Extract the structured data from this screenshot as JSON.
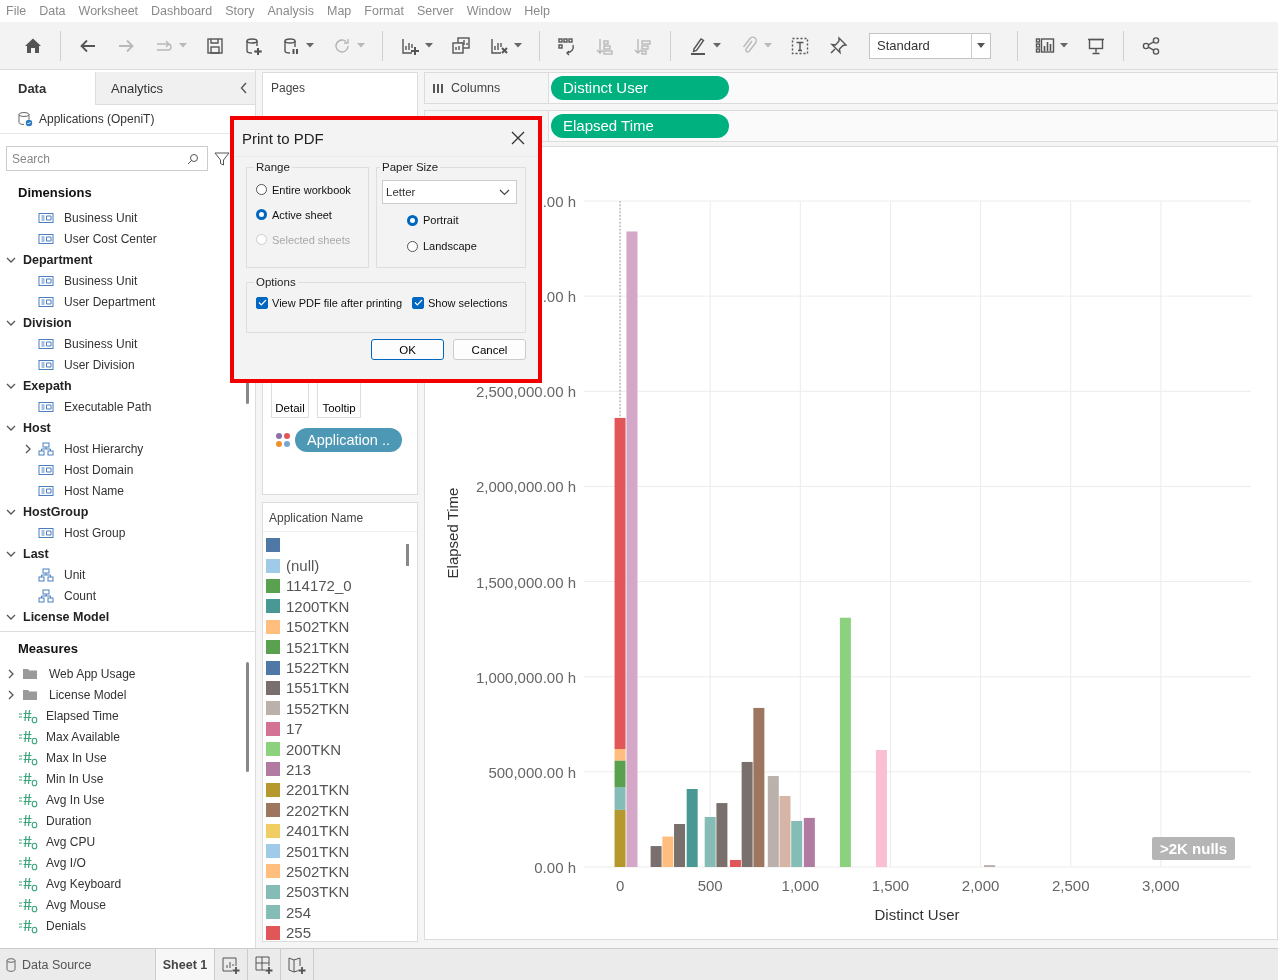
{
  "menu": [
    "File",
    "Data",
    "Worksheet",
    "Dashboard",
    "Story",
    "Analysis",
    "Map",
    "Format",
    "Server",
    "Window",
    "Help"
  ],
  "toolbar": {
    "buttons": [
      {
        "kind": "home",
        "disabled": false
      },
      {
        "kind": "separator"
      },
      {
        "kind": "back",
        "disabled": false
      },
      {
        "kind": "forward",
        "disabled": true
      },
      {
        "kind": "redo",
        "disabled": true,
        "caret": true
      },
      {
        "kind": "save",
        "disabled": false
      },
      {
        "kind": "new_source",
        "disabled": false
      },
      {
        "kind": "pause",
        "disabled": false,
        "caret": true
      },
      {
        "kind": "refresh",
        "disabled": true,
        "caret": true
      },
      {
        "kind": "separator"
      },
      {
        "kind": "new_sheet",
        "disabled": false,
        "caret": true
      },
      {
        "kind": "duplicate",
        "disabled": false
      },
      {
        "kind": "clear",
        "disabled": false,
        "caret": true
      },
      {
        "kind": "separator"
      },
      {
        "kind": "swap",
        "disabled": false
      },
      {
        "kind": "sort_asc",
        "disabled": true
      },
      {
        "kind": "sort_desc",
        "disabled": true
      },
      {
        "kind": "separator"
      },
      {
        "kind": "highlight",
        "disabled": false,
        "caret": true
      },
      {
        "kind": "annotate",
        "disabled": true,
        "caret": true
      },
      {
        "kind": "textbox",
        "disabled": false
      },
      {
        "kind": "pin",
        "disabled": false
      },
      {
        "kind": "fit",
        "value": "Standard"
      },
      {
        "kind": "separator"
      },
      {
        "kind": "showme",
        "disabled": false,
        "caret": true
      },
      {
        "kind": "present",
        "disabled": false
      },
      {
        "kind": "separator"
      },
      {
        "kind": "share",
        "disabled": false
      }
    ]
  },
  "data_pane": {
    "tabs": [
      {
        "label": "Data",
        "selected": true
      },
      {
        "label": "Analytics",
        "selected": false
      }
    ],
    "source": "Applications (OpeniT)",
    "search": {
      "placeholder": "Search"
    },
    "dimensions": {
      "title": "Dimensions",
      "items": [
        {
          "kind": "field",
          "label": "Business Unit"
        },
        {
          "kind": "field",
          "label": "User Cost Center"
        },
        {
          "kind": "group",
          "label": "Department",
          "expanded": true,
          "children": [
            {
              "kind": "field",
              "label": "Business Unit"
            },
            {
              "kind": "field",
              "label": "User Department"
            }
          ]
        },
        {
          "kind": "group",
          "label": "Division",
          "expanded": true,
          "children": [
            {
              "kind": "field",
              "label": "Business Unit"
            },
            {
              "kind": "field",
              "label": "User Division"
            }
          ]
        },
        {
          "kind": "group",
          "label": "Exepath",
          "expanded": true,
          "children": [
            {
              "kind": "field",
              "label": "Executable Path"
            }
          ]
        },
        {
          "kind": "group",
          "label": "Host",
          "expanded": true,
          "children": [
            {
              "kind": "hierarchy",
              "label": "Host Hierarchy",
              "expanded": false
            },
            {
              "kind": "field",
              "label": "Host Domain"
            },
            {
              "kind": "field",
              "label": "Host Name"
            }
          ]
        },
        {
          "kind": "group",
          "label": "HostGroup",
          "expanded": true,
          "children": [
            {
              "kind": "field",
              "label": "Host Group"
            }
          ]
        },
        {
          "kind": "group",
          "label": "Last",
          "expanded": true,
          "children": [
            {
              "kind": "level",
              "label": "Unit"
            },
            {
              "kind": "level",
              "label": "Count"
            }
          ]
        },
        {
          "kind": "group",
          "label": "License Model",
          "expanded": true
        }
      ]
    },
    "measures": {
      "title": "Measures",
      "items": [
        {
          "kind": "folder",
          "label": "Web App Usage",
          "expanded": false
        },
        {
          "kind": "folder",
          "label": "License Model",
          "expanded": false
        },
        {
          "kind": "measure",
          "label": "Elapsed Time"
        },
        {
          "kind": "measure",
          "label": "Max Available"
        },
        {
          "kind": "measure",
          "label": "Max In Use"
        },
        {
          "kind": "measure",
          "label": "Min In Use"
        },
        {
          "kind": "measure",
          "label": "Avg In Use"
        },
        {
          "kind": "measure",
          "label": "Duration"
        },
        {
          "kind": "measure",
          "label": "Avg CPU"
        },
        {
          "kind": "measure",
          "label": "Avg I/O"
        },
        {
          "kind": "measure",
          "label": "Avg Keyboard"
        },
        {
          "kind": "measure",
          "label": "Avg Mouse"
        },
        {
          "kind": "measure",
          "label": "Denials"
        }
      ]
    }
  },
  "pages_shelf": {
    "title": "Pages"
  },
  "marks": {
    "cards": [
      {
        "label": "Detail"
      },
      {
        "label": "Tooltip"
      }
    ],
    "color_field": "Application .."
  },
  "legend": {
    "title": "Application Name",
    "items": [
      {
        "color": "#4e79a7"
      },
      {
        "label": "(null)",
        "color": "#a0cbe8"
      },
      {
        "label": "114172_0",
        "color": "#59a14f"
      },
      {
        "label": "1200TKN",
        "color": "#499894"
      },
      {
        "label": "1502TKN",
        "color": "#ffbe7d"
      },
      {
        "label": "1521TKN",
        "color": "#59a14f"
      },
      {
        "label": "1522TKN",
        "color": "#4e79a7"
      },
      {
        "label": "1551TKN",
        "color": "#79706e"
      },
      {
        "label": "1552TKN",
        "color": "#bab0ac"
      },
      {
        "label": "17",
        "color": "#d37295"
      },
      {
        "label": "200TKN",
        "color": "#8cd17d"
      },
      {
        "label": "213",
        "color": "#b07aa1"
      },
      {
        "label": "2201TKN",
        "color": "#b6992d"
      },
      {
        "label": "2202TKN",
        "color": "#9d7660"
      },
      {
        "label": "2401TKN",
        "color": "#f1ce63"
      },
      {
        "label": "2501TKN",
        "color": "#a0cbe8"
      },
      {
        "label": "2502TKN",
        "color": "#ffbe7d"
      },
      {
        "label": "2503TKN",
        "color": "#86bcb6"
      },
      {
        "label": "254",
        "color": "#86bcb6"
      },
      {
        "label": "255",
        "color": "#e15759"
      }
    ]
  },
  "shelves": [
    {
      "label": "Columns",
      "pill": "Distinct User"
    },
    {
      "pill": "Elapsed Time"
    }
  ],
  "chart": {
    "nulls_badge": ">2K nulls",
    "covered_tick_labels": [
      ".00 h",
      ".00 h"
    ],
    "chart_data": {
      "type": "bar",
      "xlabel": "Distinct User",
      "ylabel": "Elapsed Time",
      "stacked": true,
      "grid": true,
      "x": [
        0,
        66,
        200,
        265,
        330,
        400,
        500,
        565,
        640,
        705,
        770,
        850,
        915,
        980,
        1050,
        1250,
        1450,
        2050
      ],
      "series": [
        {
          "color": "#b6992d",
          "values": [
            300000,
            null,
            null,
            null,
            null,
            null,
            null,
            null,
            null,
            null,
            null,
            null,
            null,
            null,
            null,
            null,
            null,
            null
          ]
        },
        {
          "color": "#86bcb6",
          "values": [
            120000,
            null,
            null,
            null,
            null,
            null,
            263000,
            null,
            null,
            null,
            null,
            null,
            null,
            242000,
            null,
            null,
            null,
            null
          ]
        },
        {
          "color": "#59a14f",
          "values": [
            140000,
            null,
            null,
            null,
            null,
            null,
            null,
            null,
            null,
            null,
            null,
            null,
            null,
            null,
            null,
            null,
            null,
            null
          ]
        },
        {
          "color": "#ffbe7d",
          "values": [
            60000,
            null,
            null,
            160000,
            null,
            null,
            null,
            null,
            null,
            null,
            null,
            null,
            null,
            null,
            null,
            null,
            null,
            null
          ]
        },
        {
          "color": "#e15759",
          "values": [
            1740000,
            null,
            null,
            null,
            null,
            null,
            null,
            null,
            37000,
            null,
            null,
            null,
            null,
            null,
            null,
            null,
            null,
            null
          ]
        },
        {
          "color": "#d4a6c8",
          "values": [
            null,
            3340000,
            null,
            null,
            null,
            null,
            null,
            null,
            null,
            null,
            null,
            null,
            null,
            null,
            null,
            null,
            null,
            null
          ]
        },
        {
          "color": "#79706e",
          "values": [
            null,
            null,
            110000,
            null,
            226000,
            null,
            null,
            336000,
            null,
            552000,
            null,
            null,
            null,
            null,
            null,
            null,
            null,
            null
          ]
        },
        {
          "color": "#499894",
          "values": [
            null,
            null,
            null,
            null,
            null,
            410000,
            null,
            null,
            null,
            null,
            null,
            null,
            null,
            null,
            null,
            null,
            null,
            null
          ]
        },
        {
          "color": "#9d7660",
          "values": [
            null,
            null,
            null,
            null,
            null,
            null,
            null,
            null,
            null,
            null,
            836000,
            null,
            null,
            null,
            null,
            null,
            null,
            null
          ]
        },
        {
          "color": "#bab0ac",
          "values": [
            null,
            null,
            null,
            null,
            null,
            null,
            null,
            null,
            null,
            null,
            null,
            478000,
            null,
            null,
            null,
            null,
            null,
            10000
          ]
        },
        {
          "color": "#d7b5a6",
          "values": [
            null,
            null,
            null,
            null,
            null,
            null,
            null,
            null,
            null,
            null,
            null,
            null,
            373000,
            null,
            null,
            null,
            null,
            null
          ]
        },
        {
          "color": "#b07aa1",
          "values": [
            null,
            null,
            null,
            null,
            null,
            null,
            null,
            null,
            null,
            null,
            null,
            null,
            null,
            null,
            258000,
            null,
            null,
            null
          ]
        },
        {
          "color": "#8cd17d",
          "values": [
            null,
            null,
            null,
            null,
            null,
            null,
            null,
            null,
            null,
            null,
            null,
            null,
            null,
            null,
            null,
            1310000,
            null,
            null
          ]
        },
        {
          "color": "#fabfd2",
          "values": [
            null,
            null,
            null,
            null,
            null,
            null,
            null,
            null,
            null,
            null,
            null,
            null,
            null,
            null,
            null,
            null,
            615000,
            null
          ]
        }
      ],
      "ref_lines": [
        {
          "axis": "x",
          "value": 0
        }
      ],
      "xlim": [
        -200,
        3500
      ],
      "ylim": [
        0,
        3500000
      ],
      "xticks": [
        0,
        500,
        {
          "value": 1000,
          "label": "1,000"
        },
        {
          "value": 1500,
          "label": "1,500"
        },
        {
          "value": 2000,
          "label": "2,000"
        },
        {
          "value": 2500,
          "label": "2,500"
        },
        {
          "value": 3000,
          "label": "3,000"
        }
      ],
      "yticks": [
        {
          "value": 0,
          "label": "0.00 h"
        },
        {
          "value": 500000,
          "label": "500,000.00 h"
        },
        {
          "value": 1000000,
          "label": "1,000,000.00 h"
        },
        {
          "value": 1500000,
          "label": "1,500,000.00 h"
        },
        {
          "value": 2000000,
          "label": "2,000,000.00 h"
        },
        {
          "value": 2500000,
          "label": "2,500,000.00 h"
        }
      ]
    }
  },
  "dialog": {
    "title": "Print to PDF",
    "highlighted": true,
    "range": {
      "title": "Range",
      "options": [
        {
          "label": "Entire workbook",
          "selected": false,
          "disabled": false
        },
        {
          "label": "Active sheet",
          "selected": true,
          "disabled": false
        },
        {
          "label": "Selected sheets",
          "selected": false,
          "disabled": true
        }
      ]
    },
    "paper_size": {
      "title": "Paper Size",
      "value": "Letter",
      "orientations": [
        {
          "label": "Portrait",
          "selected": true
        },
        {
          "label": "Landscape",
          "selected": false
        }
      ]
    },
    "options": {
      "title": "Options",
      "items": [
        {
          "label": "View PDF file after printing",
          "checked": true
        },
        {
          "label": "Show selections",
          "checked": true
        }
      ]
    },
    "buttons": [
      {
        "label": "OK",
        "kind": "default"
      },
      {
        "label": "Cancel",
        "kind": "normal"
      }
    ]
  },
  "sheet_tabs": [
    {
      "label": "Data Source",
      "kind": "source",
      "selected": false
    },
    {
      "label": "Sheet 1",
      "kind": "sheet",
      "selected": true
    }
  ]
}
